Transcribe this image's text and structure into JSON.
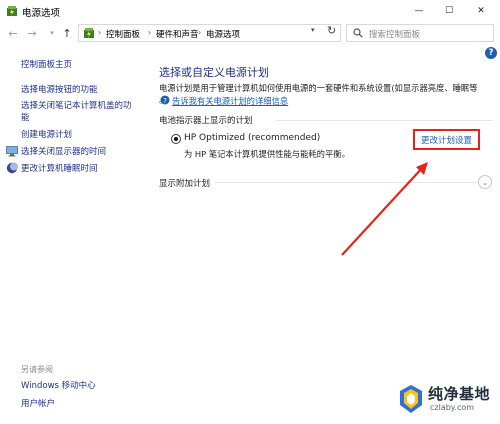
{
  "window": {
    "title": "电源选项",
    "controls": {
      "minimize": "—",
      "maximize": "☐",
      "close": "✕"
    }
  },
  "nav": {
    "back": "←",
    "forward": "→",
    "dropdown": "▾",
    "up": "↑",
    "breadcrumb": [
      "控制面板",
      "硬件和声音",
      "电源选项"
    ],
    "separator": "›",
    "addr_dropdown": "▾",
    "refresh": "↻",
    "search_placeholder": "搜索控制面板"
  },
  "help": "?",
  "sidebar": {
    "home": "控制面板主页",
    "links": [
      "选择电源按钮的功能",
      "选择关闭笔记本计算机盖的功",
      "能",
      "创建电源计划"
    ],
    "icon_links": [
      {
        "label": "选择关闭显示器的时间",
        "icon": "display-power-icon"
      },
      {
        "label": "更改计算机睡眠时间",
        "icon": "moon-sleep-icon"
      }
    ],
    "see_also": {
      "heading": "另请参阅",
      "items": [
        "Windows 移动中心",
        "用户帐户"
      ]
    }
  },
  "main": {
    "title": "选择或自定义电源计划",
    "description_line1": "电源计划是用于管理计算机如何使用电源的一套硬件和系统设置(如显示器亮度、睡眠等",
    "description_line2": "。",
    "learn_more": "告诉我有关电源计划的详细信息",
    "battery_section": "电池指示器上显示的计划",
    "plan": {
      "name": "HP Optimized (recommended)",
      "description": "为 HP 笔记本计算机提供性能与能耗的平衡。",
      "selected": true,
      "change_link": "更改计划设置"
    },
    "extra_section": "显示附加计划",
    "expand": "⌄"
  },
  "watermark": {
    "name": "纯净基地",
    "url": "czlaby.com"
  },
  "colors": {
    "link": "#1e3287",
    "accent_blue": "#1a5fb4",
    "highlight_red": "#e1251b"
  }
}
